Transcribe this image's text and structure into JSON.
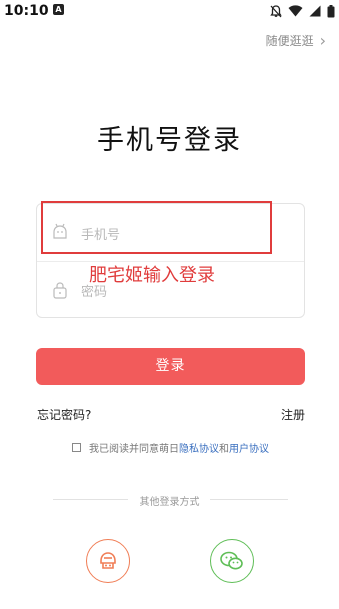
{
  "status_bar": {
    "time": "10:10",
    "app_icon_letter": "A"
  },
  "header": {
    "skip_label": "随便逛逛",
    "skip_arrow": "›"
  },
  "title": "手机号登录",
  "form": {
    "phone_placeholder": "手机号",
    "password_placeholder": "密码"
  },
  "annotation": {
    "text": "肥宅姬输入登录",
    "color": "#e03c3c"
  },
  "login_button": {
    "label": "登录",
    "color": "#f25b5b"
  },
  "links": {
    "forgot": "忘记密码?",
    "register": "注册"
  },
  "agreement": {
    "prefix": "我已阅读并同意萌日",
    "privacy": "隐私协议",
    "and": "和",
    "user": "用户协议",
    "checked": false,
    "link_color": "#3a6fbf"
  },
  "other_login": {
    "label": "其他登录方式",
    "providers": [
      {
        "name": "weibo-icon",
        "color": "#f07d55"
      },
      {
        "name": "wechat-icon",
        "color": "#5fbe57"
      }
    ]
  }
}
